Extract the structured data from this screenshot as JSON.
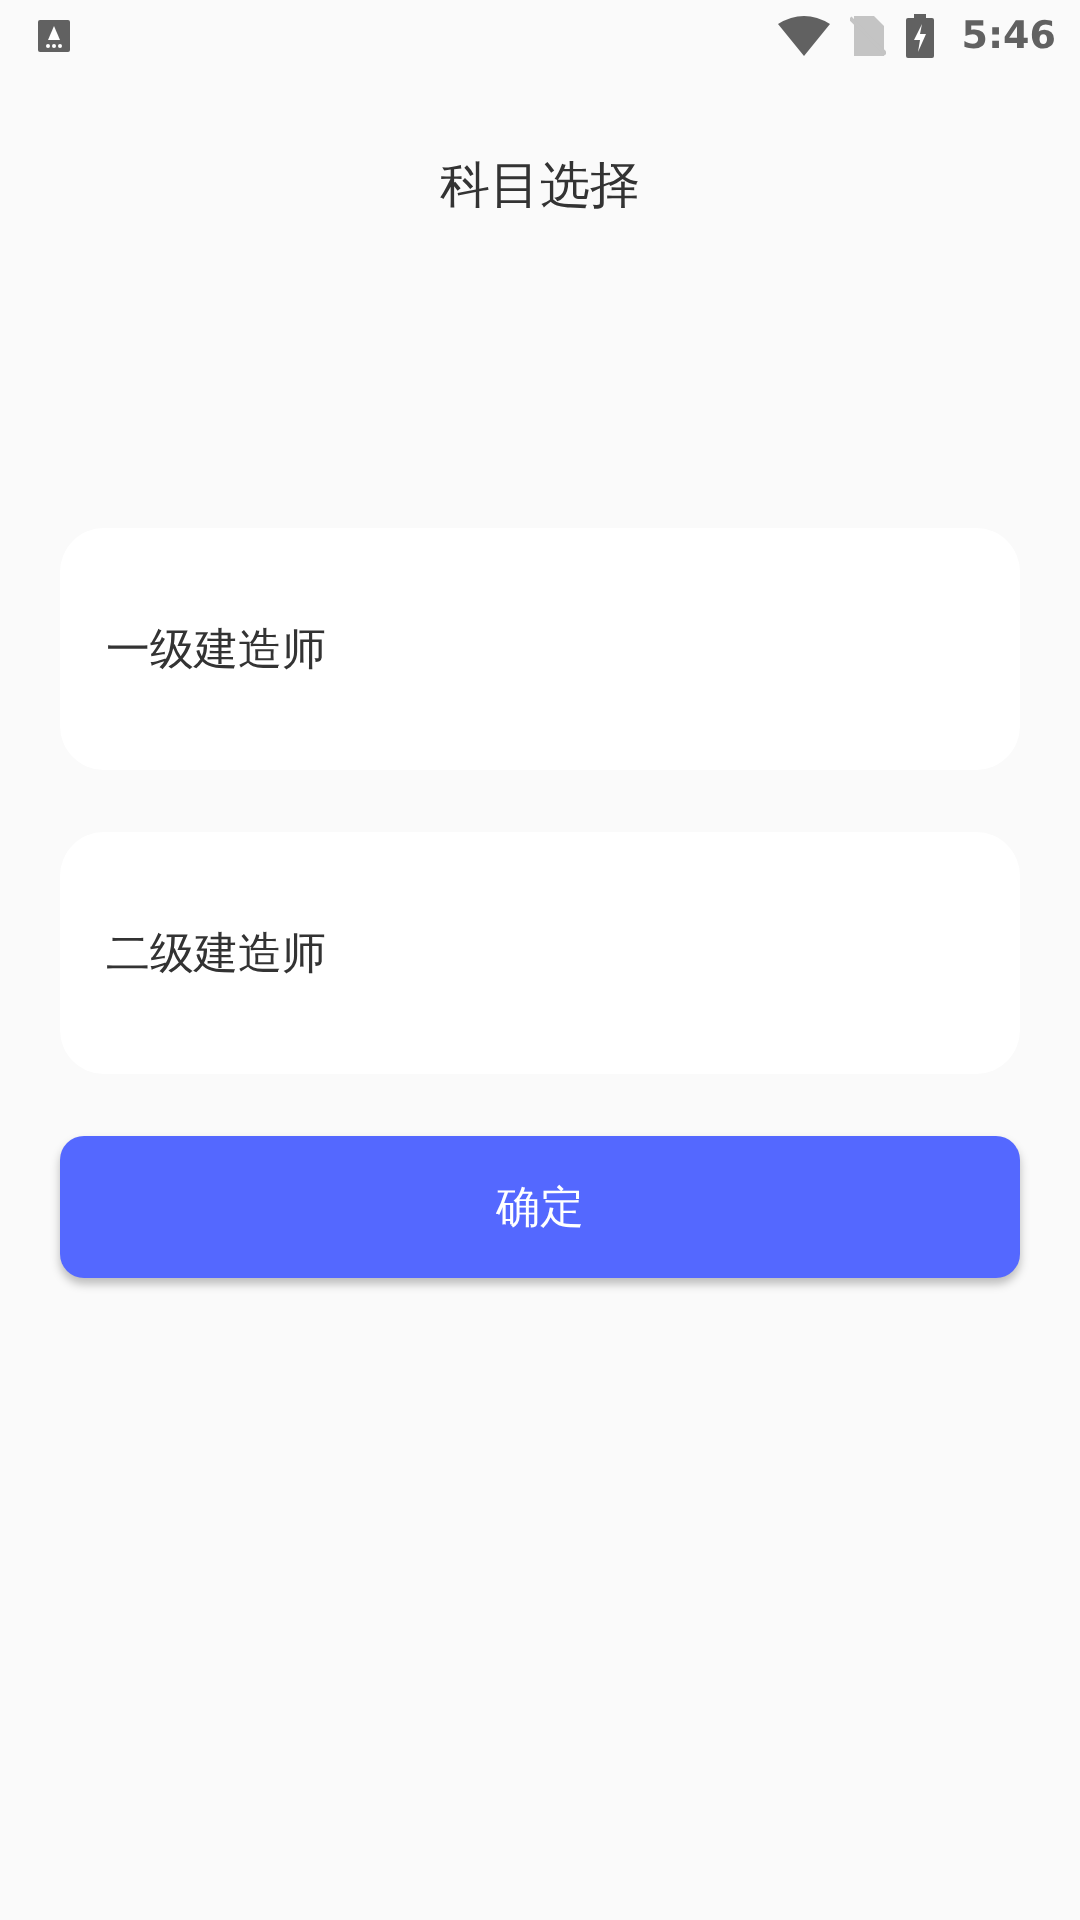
{
  "status_bar": {
    "time": "5:46"
  },
  "title": "科目选择",
  "options": [
    {
      "label": "一级建造师"
    },
    {
      "label": "二级建造师"
    }
  ],
  "confirm_button": "确定"
}
